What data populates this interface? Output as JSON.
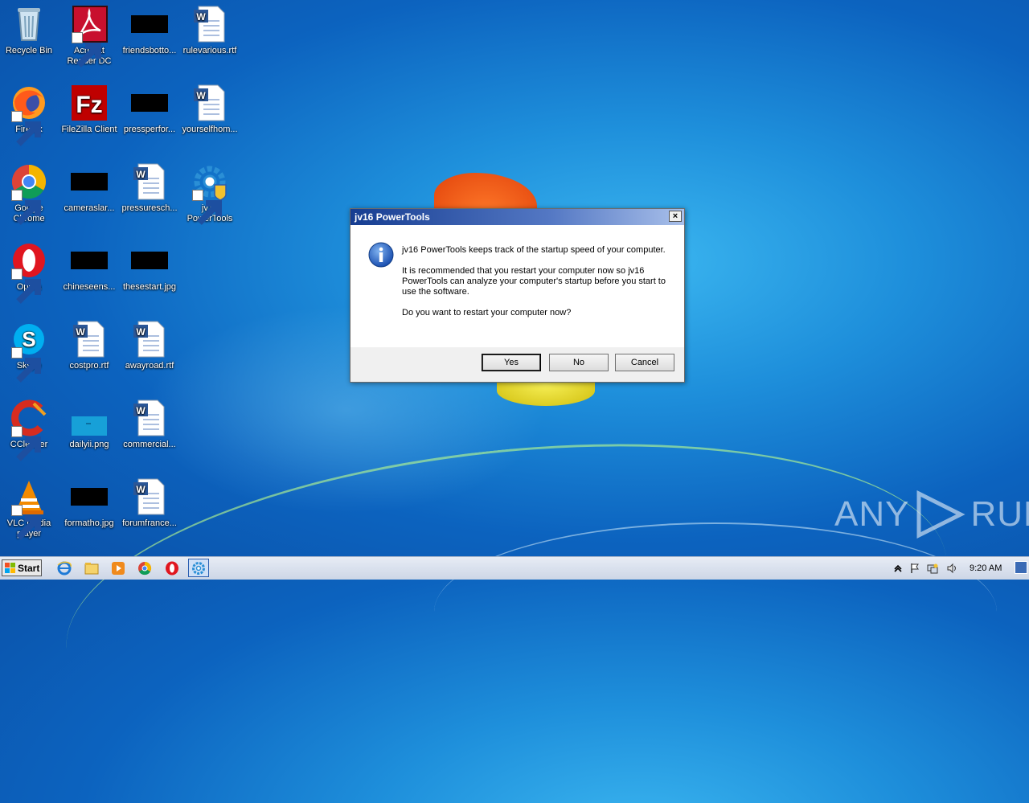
{
  "desktop": {
    "icons": [
      {
        "label": "Recycle Bin",
        "icon": "recycle-bin-icon"
      },
      {
        "label": "Acrobat Reader DC",
        "icon": "acrobat-icon"
      },
      {
        "label": "friendsbotto...",
        "icon": "black-thumbnail-icon"
      },
      {
        "label": "rulevarious.rtf",
        "icon": "word-document-icon"
      },
      {
        "label": "Firefox",
        "icon": "firefox-icon"
      },
      {
        "label": "FileZilla Client",
        "icon": "filezilla-icon"
      },
      {
        "label": "pressperfor...",
        "icon": "black-thumbnail-icon"
      },
      {
        "label": "yourselfhom...",
        "icon": "word-document-icon"
      },
      {
        "label": "Google Chrome",
        "icon": "chrome-icon"
      },
      {
        "label": "cameraslar...",
        "icon": "black-thumbnail-icon"
      },
      {
        "label": "pressuresch...",
        "icon": "word-document-icon"
      },
      {
        "label": "jv16 PowerTools",
        "icon": "jv16-icon"
      },
      {
        "label": "Opera",
        "icon": "opera-icon"
      },
      {
        "label": "chineseens...",
        "icon": "black-thumbnail-icon"
      },
      {
        "label": "thesestart.jpg",
        "icon": "black-thumbnail-icon"
      },
      {
        "label": "Skype",
        "icon": "skype-icon"
      },
      {
        "label": "costpro.rtf",
        "icon": "word-document-icon"
      },
      {
        "label": "awayroad.rtf",
        "icon": "word-document-icon"
      },
      {
        "label": "CCleaner",
        "icon": "ccleaner-icon"
      },
      {
        "label": "dailyii.png",
        "icon": "image-thumbnail-icon"
      },
      {
        "label": "commercial...",
        "icon": "word-document-icon"
      },
      {
        "label": "VLC media player",
        "icon": "vlc-icon"
      },
      {
        "label": "formatho.jpg",
        "icon": "black-thumbnail-icon"
      },
      {
        "label": "forumfrance...",
        "icon": "word-document-icon"
      }
    ]
  },
  "dialog": {
    "title": "jv16 PowerTools",
    "close_label": "×",
    "message_1": "jv16 PowerTools keeps track of the startup speed of your computer.",
    "message_2": "It is recommended that you restart your computer now so jv16 PowerTools can analyze your computer's startup before you start to use the software.",
    "message_3": "Do you want to restart your computer now?",
    "buttons": {
      "yes": "Yes",
      "no": "No",
      "cancel": "Cancel"
    }
  },
  "taskbar": {
    "start_label": "Start",
    "clock": "9:20 AM"
  },
  "watermark": {
    "left": "ANY",
    "right": "RUN"
  },
  "colors": {
    "desktop": "#1e8fdb",
    "titlebar": "#163d91",
    "taskbar": "#dbe2ee"
  }
}
